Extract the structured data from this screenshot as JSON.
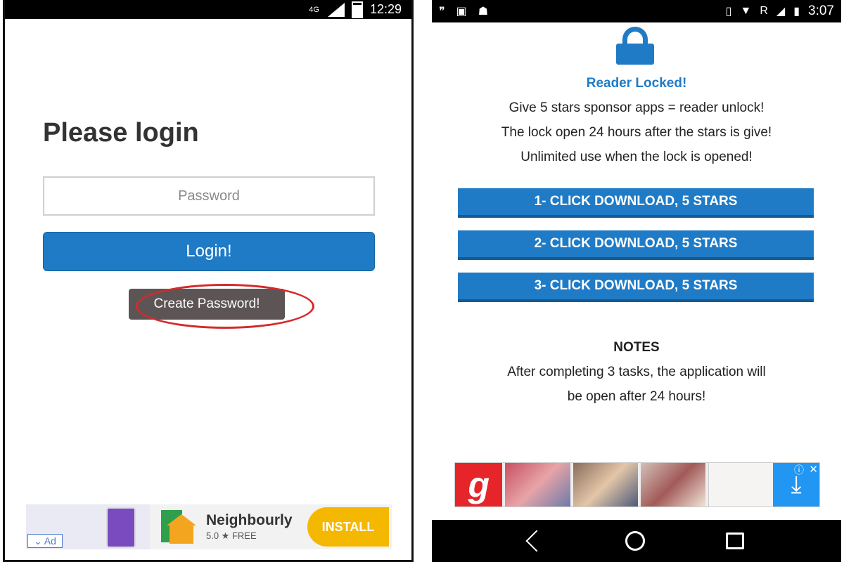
{
  "left_phone": {
    "status_bar": {
      "network": "4G",
      "time": "12:29"
    },
    "title": "Please login",
    "password_input": {
      "placeholder": "Password",
      "value": ""
    },
    "login_button": "Login!",
    "create_password_button": "Create Password!",
    "ad": {
      "label": "Ad",
      "app_name": "Neighbourly",
      "rating": "5.0 ★ FREE",
      "install_button": "INSTALL"
    }
  },
  "right_phone": {
    "status_bar": {
      "time": "3:07",
      "roaming": "R"
    },
    "locked_title": "Reader Locked!",
    "info_lines": [
      "Give 5 stars sponsor apps = reader unlock!",
      "The lock open 24 hours after the stars is give!",
      "Unlimited use when the lock is opened!"
    ],
    "download_buttons": [
      "1- CLICK DOWNLOAD, 5 STARS",
      "2- CLICK DOWNLOAD, 5 STARS",
      "3- CLICK DOWNLOAD, 5 STARS"
    ],
    "notes": {
      "title": "NOTES",
      "lines": [
        "After completing 3 tasks, the application will",
        "be open after 24 hours!"
      ]
    },
    "ad": {
      "logo_letter": "g"
    }
  },
  "colors": {
    "primary_blue": "#1f7bc6",
    "annotation_red": "#d42a2a",
    "install_yellow": "#f5b800"
  }
}
